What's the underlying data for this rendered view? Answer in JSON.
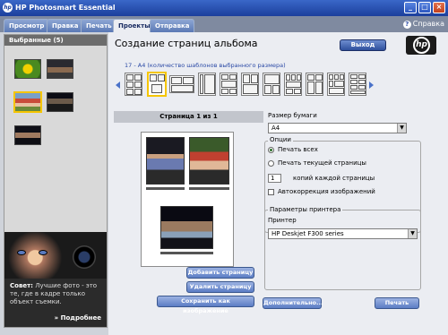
{
  "window": {
    "title": "HP Photosmart Essential",
    "logo": "hp"
  },
  "tabs": [
    {
      "label": "Просмотр",
      "active": false
    },
    {
      "label": "Правка",
      "active": false
    },
    {
      "label": "Печать",
      "active": false
    },
    {
      "label": "Проекты",
      "active": true
    },
    {
      "label": "Отправка",
      "active": false
    }
  ],
  "help": {
    "label": "Справка",
    "icon": "question-icon"
  },
  "sidebar": {
    "title": "Выбранные (5)",
    "tip": {
      "title": "Совет:",
      "text": "Лучшие фото - это те, где в кадре только объект съемки.",
      "more": "» Подробнее"
    }
  },
  "main": {
    "title": "Создание страниц альбома",
    "exit_label": "Выход",
    "brand_logo": "hp",
    "templates_info": "17 - A4 (количество шаблонов выбранного размера)",
    "page_label": "Страница 1 из 1",
    "buttons": {
      "add_page": "Добавить страницу",
      "delete_page": "Удалить страницу",
      "save_image": "Сохранить как изображение",
      "advanced": "Дополнительно...",
      "print": "Печать"
    }
  },
  "settings": {
    "paper_size_label": "Размер бумаги",
    "paper_size_value": "A4",
    "options_title": "Опции",
    "print_all": "Печать всех",
    "print_current": "Печать текущей страницы",
    "copies_value": "1",
    "copies_label": "копий каждой страницы",
    "autocorrect": "Автокоррекция изображений",
    "printer_params_title": "Параметры принтера",
    "printer_label": "Принтер",
    "printer_value": "HP Deskjet F300 series"
  },
  "colors": {
    "accent": "#2e4f9d",
    "selection": "#f5c500",
    "title_bar": "#1b3f9c"
  }
}
